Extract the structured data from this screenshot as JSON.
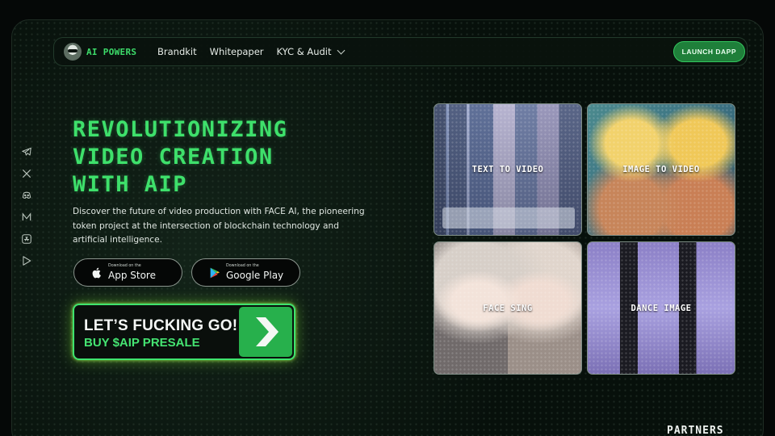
{
  "brand": {
    "name": "AI POWERS",
    "accent": "#3ee06b"
  },
  "nav": {
    "links": [
      {
        "label": "Brandkit"
      },
      {
        "label": "Whitepaper"
      },
      {
        "label": "KYC & Audit"
      }
    ],
    "launch_label": "LAUNCH DAPP"
  },
  "social": [
    {
      "icon": "telegram-icon"
    },
    {
      "icon": "x-icon"
    },
    {
      "icon": "discord-icon"
    },
    {
      "icon": "medium-icon"
    },
    {
      "icon": "app-store-icon"
    },
    {
      "icon": "google-play-icon"
    }
  ],
  "hero": {
    "title_lines": [
      "REVOLUTIONIZING",
      "VIDEO CREATION",
      "WITH AIP"
    ],
    "description": "Discover the future of video production with FACE AI, the pioneering token project at the intersection of blockchain technology and artificial intelligence."
  },
  "stores": {
    "apple": {
      "small": "Download on the",
      "big": "App Store"
    },
    "google": {
      "small": "Download on the",
      "big": "Google Play"
    }
  },
  "cta": {
    "line1": "LET’S FUCKING GO!",
    "line2": "BUY $AIP PRESALE"
  },
  "features": [
    {
      "label": "TEXT TO VIDEO"
    },
    {
      "label": "IMAGE TO VIDEO"
    },
    {
      "label": "FACE SING"
    },
    {
      "label": "DANCE IMAGE"
    }
  ],
  "partners_heading": "PARTNERS"
}
